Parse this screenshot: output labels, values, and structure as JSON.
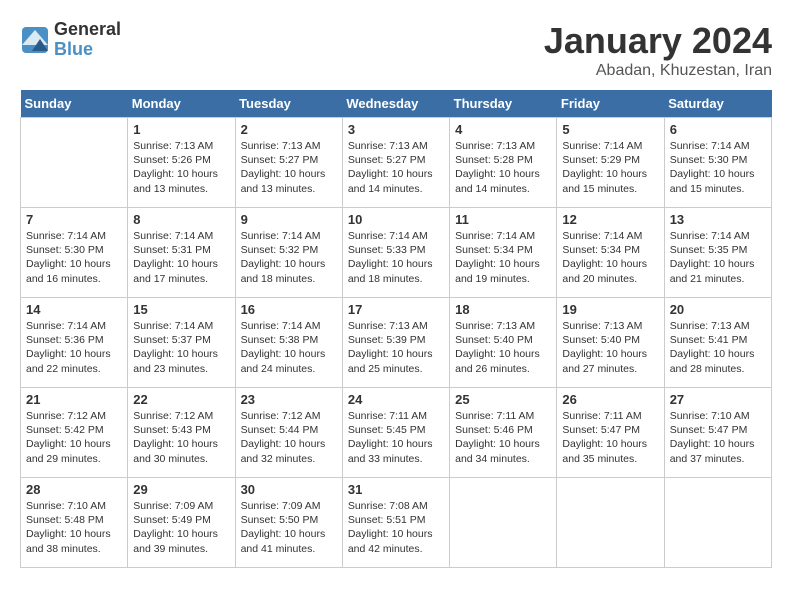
{
  "header": {
    "logo_general": "General",
    "logo_blue": "Blue",
    "month_title": "January 2024",
    "location": "Abadan, Khuzestan, Iran"
  },
  "weekdays": [
    "Sunday",
    "Monday",
    "Tuesday",
    "Wednesday",
    "Thursday",
    "Friday",
    "Saturday"
  ],
  "weeks": [
    [
      {
        "date": "",
        "sunrise": "",
        "sunset": "",
        "daylight": ""
      },
      {
        "date": "1",
        "sunrise": "Sunrise: 7:13 AM",
        "sunset": "Sunset: 5:26 PM",
        "daylight": "Daylight: 10 hours and 13 minutes."
      },
      {
        "date": "2",
        "sunrise": "Sunrise: 7:13 AM",
        "sunset": "Sunset: 5:27 PM",
        "daylight": "Daylight: 10 hours and 13 minutes."
      },
      {
        "date": "3",
        "sunrise": "Sunrise: 7:13 AM",
        "sunset": "Sunset: 5:27 PM",
        "daylight": "Daylight: 10 hours and 14 minutes."
      },
      {
        "date": "4",
        "sunrise": "Sunrise: 7:13 AM",
        "sunset": "Sunset: 5:28 PM",
        "daylight": "Daylight: 10 hours and 14 minutes."
      },
      {
        "date": "5",
        "sunrise": "Sunrise: 7:14 AM",
        "sunset": "Sunset: 5:29 PM",
        "daylight": "Daylight: 10 hours and 15 minutes."
      },
      {
        "date": "6",
        "sunrise": "Sunrise: 7:14 AM",
        "sunset": "Sunset: 5:30 PM",
        "daylight": "Daylight: 10 hours and 15 minutes."
      }
    ],
    [
      {
        "date": "7",
        "sunrise": "Sunrise: 7:14 AM",
        "sunset": "Sunset: 5:30 PM",
        "daylight": "Daylight: 10 hours and 16 minutes."
      },
      {
        "date": "8",
        "sunrise": "Sunrise: 7:14 AM",
        "sunset": "Sunset: 5:31 PM",
        "daylight": "Daylight: 10 hours and 17 minutes."
      },
      {
        "date": "9",
        "sunrise": "Sunrise: 7:14 AM",
        "sunset": "Sunset: 5:32 PM",
        "daylight": "Daylight: 10 hours and 18 minutes."
      },
      {
        "date": "10",
        "sunrise": "Sunrise: 7:14 AM",
        "sunset": "Sunset: 5:33 PM",
        "daylight": "Daylight: 10 hours and 18 minutes."
      },
      {
        "date": "11",
        "sunrise": "Sunrise: 7:14 AM",
        "sunset": "Sunset: 5:34 PM",
        "daylight": "Daylight: 10 hours and 19 minutes."
      },
      {
        "date": "12",
        "sunrise": "Sunrise: 7:14 AM",
        "sunset": "Sunset: 5:34 PM",
        "daylight": "Daylight: 10 hours and 20 minutes."
      },
      {
        "date": "13",
        "sunrise": "Sunrise: 7:14 AM",
        "sunset": "Sunset: 5:35 PM",
        "daylight": "Daylight: 10 hours and 21 minutes."
      }
    ],
    [
      {
        "date": "14",
        "sunrise": "Sunrise: 7:14 AM",
        "sunset": "Sunset: 5:36 PM",
        "daylight": "Daylight: 10 hours and 22 minutes."
      },
      {
        "date": "15",
        "sunrise": "Sunrise: 7:14 AM",
        "sunset": "Sunset: 5:37 PM",
        "daylight": "Daylight: 10 hours and 23 minutes."
      },
      {
        "date": "16",
        "sunrise": "Sunrise: 7:14 AM",
        "sunset": "Sunset: 5:38 PM",
        "daylight": "Daylight: 10 hours and 24 minutes."
      },
      {
        "date": "17",
        "sunrise": "Sunrise: 7:13 AM",
        "sunset": "Sunset: 5:39 PM",
        "daylight": "Daylight: 10 hours and 25 minutes."
      },
      {
        "date": "18",
        "sunrise": "Sunrise: 7:13 AM",
        "sunset": "Sunset: 5:40 PM",
        "daylight": "Daylight: 10 hours and 26 minutes."
      },
      {
        "date": "19",
        "sunrise": "Sunrise: 7:13 AM",
        "sunset": "Sunset: 5:40 PM",
        "daylight": "Daylight: 10 hours and 27 minutes."
      },
      {
        "date": "20",
        "sunrise": "Sunrise: 7:13 AM",
        "sunset": "Sunset: 5:41 PM",
        "daylight": "Daylight: 10 hours and 28 minutes."
      }
    ],
    [
      {
        "date": "21",
        "sunrise": "Sunrise: 7:12 AM",
        "sunset": "Sunset: 5:42 PM",
        "daylight": "Daylight: 10 hours and 29 minutes."
      },
      {
        "date": "22",
        "sunrise": "Sunrise: 7:12 AM",
        "sunset": "Sunset: 5:43 PM",
        "daylight": "Daylight: 10 hours and 30 minutes."
      },
      {
        "date": "23",
        "sunrise": "Sunrise: 7:12 AM",
        "sunset": "Sunset: 5:44 PM",
        "daylight": "Daylight: 10 hours and 32 minutes."
      },
      {
        "date": "24",
        "sunrise": "Sunrise: 7:11 AM",
        "sunset": "Sunset: 5:45 PM",
        "daylight": "Daylight: 10 hours and 33 minutes."
      },
      {
        "date": "25",
        "sunrise": "Sunrise: 7:11 AM",
        "sunset": "Sunset: 5:46 PM",
        "daylight": "Daylight: 10 hours and 34 minutes."
      },
      {
        "date": "26",
        "sunrise": "Sunrise: 7:11 AM",
        "sunset": "Sunset: 5:47 PM",
        "daylight": "Daylight: 10 hours and 35 minutes."
      },
      {
        "date": "27",
        "sunrise": "Sunrise: 7:10 AM",
        "sunset": "Sunset: 5:47 PM",
        "daylight": "Daylight: 10 hours and 37 minutes."
      }
    ],
    [
      {
        "date": "28",
        "sunrise": "Sunrise: 7:10 AM",
        "sunset": "Sunset: 5:48 PM",
        "daylight": "Daylight: 10 hours and 38 minutes."
      },
      {
        "date": "29",
        "sunrise": "Sunrise: 7:09 AM",
        "sunset": "Sunset: 5:49 PM",
        "daylight": "Daylight: 10 hours and 39 minutes."
      },
      {
        "date": "30",
        "sunrise": "Sunrise: 7:09 AM",
        "sunset": "Sunset: 5:50 PM",
        "daylight": "Daylight: 10 hours and 41 minutes."
      },
      {
        "date": "31",
        "sunrise": "Sunrise: 7:08 AM",
        "sunset": "Sunset: 5:51 PM",
        "daylight": "Daylight: 10 hours and 42 minutes."
      },
      {
        "date": "",
        "sunrise": "",
        "sunset": "",
        "daylight": ""
      },
      {
        "date": "",
        "sunrise": "",
        "sunset": "",
        "daylight": ""
      },
      {
        "date": "",
        "sunrise": "",
        "sunset": "",
        "daylight": ""
      }
    ]
  ]
}
